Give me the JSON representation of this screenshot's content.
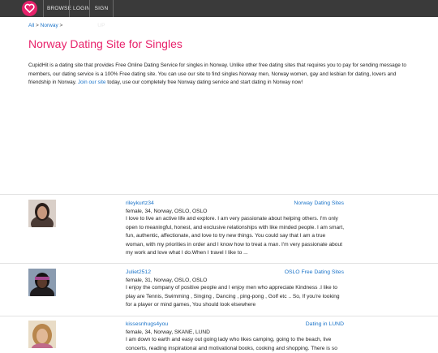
{
  "nav": {
    "browse": "BROWSE",
    "login": "LOGIN",
    "signup": "SIGN UP"
  },
  "breadcrumb": {
    "all": "All",
    "sep1": ">",
    "norway": "Norway",
    "sep2": ">"
  },
  "page": {
    "title": "Norway Dating Site for Singles",
    "intro_before": "CupidHit is a dating site that provides Free Online Dating Service for singles in Norway. Unlike other free dating sites that requires you to pay for sending message to members, our dating service is a 100% Free dating site. You can use our site to find singles Norway men, Norway women, gay and lesbian for dating, lovers and friendship in Norway. ",
    "intro_link": "Join our site",
    "intro_after": " today, use our completely free Norway dating service and start dating in Norway now!"
  },
  "profiles": [
    {
      "name": "rileykurtz34",
      "site": "Norway Dating Sites",
      "meta": "female, 34, Norway, OSLO, OSLO",
      "desc": "I love to live an active life and explore. I am very passionate about helping others. I'm only open to meaningful, honest, and exclusive relationships with like minded people. I am smart, fun, authentic, affectionate, and love to try new things. You could say that I am a true woman, with my priorities in order and I know how to treat a man. I'm very passionate about my work and love what I do.When I travel I like to ...",
      "avatar_color": "#6b4a3a"
    },
    {
      "name": "Juliet2512",
      "site": "OSLO Free Dating Sites",
      "meta": "female, 31, Norway, OSLO, OSLO",
      "desc": "I enjoy the company of positive people and I enjoy men who appreciate Kindness .I like to play are Tennis, Swimming , Singing , Dancing , ping-pong , Golf etc .. So, If you're looking for a player or mind games, You should look elsewhere",
      "avatar_color": "#2e2a2a"
    },
    {
      "name": "kissesnhugs4you",
      "site": "Dating in LUND",
      "meta": "female, 34, Norway, SKANE, LUND",
      "desc": "I am down to earth and easy out going lady who likes camping, going to the beach, live concerts, reading inspirational and motivational books, cooking and shopping. There is so",
      "avatar_color": "#c9a27a"
    }
  ]
}
